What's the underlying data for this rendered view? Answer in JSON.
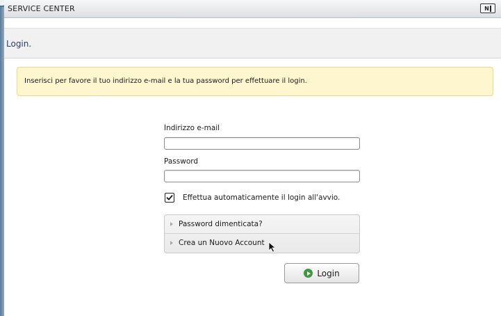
{
  "window": {
    "title": "SERVICE CENTER",
    "logo_text": "NI",
    "logo_icon": "native-instruments-logo-icon"
  },
  "page": {
    "heading": "Login."
  },
  "notice": {
    "text": "Inserisci per favore il tuo indirizzo e-mail e la tua password per effettuare il login."
  },
  "form": {
    "email_label": "Indirizzo e-mail",
    "email_value": "",
    "password_label": "Password",
    "password_value": "",
    "autologin_label": "Effettua automaticamente il login all'avvio.",
    "autologin_checked": true
  },
  "links": {
    "items": [
      {
        "label": "Password dimenticata?"
      },
      {
        "label": "Crea un Nuovo Account"
      }
    ]
  },
  "actions": {
    "login_label": "Login",
    "login_icon": "play-circle-icon",
    "login_icon_color": "#3c9a3c"
  },
  "colors": {
    "notice_bg": "#fdf6cf",
    "heading_color": "#2c3e66"
  }
}
